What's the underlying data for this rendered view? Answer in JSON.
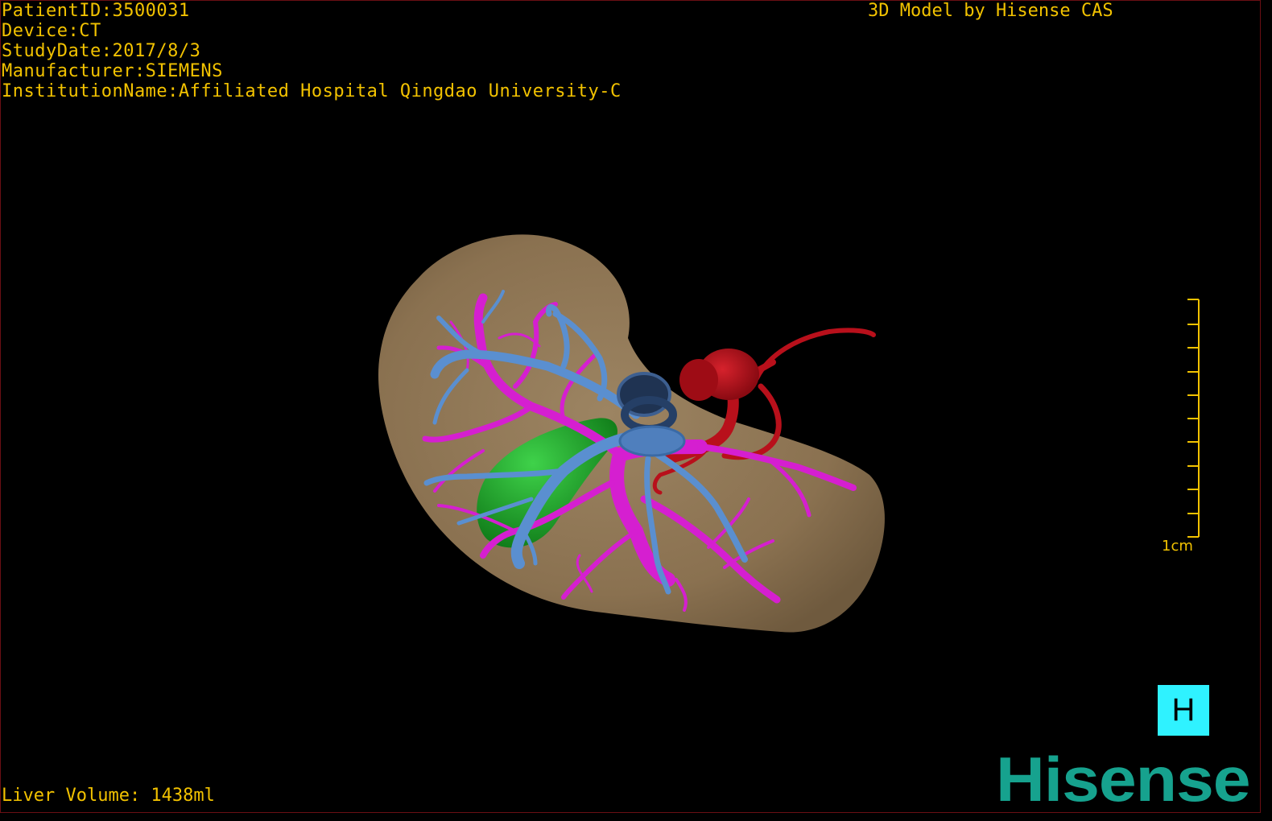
{
  "study_info": {
    "patient_id": "PatientID:3500031",
    "device": "Device:CT",
    "study_date": "StudyDate:2017/8/3",
    "manufacturer": "Manufacturer:SIEMENS",
    "institution": "InstitutionName:Affiliated Hospital Qingdao University-C"
  },
  "credit": "3D Model by Hisense CAS",
  "liver_volume": "Liver Volume: 1438ml",
  "scale_bar": {
    "label": "1cm"
  },
  "view_button": {
    "label": "H"
  },
  "logo_text": "Hisense",
  "colors": {
    "text": "#f2c200",
    "liver": "#8c7452",
    "portal_vein": "#d51fd0",
    "hepatic_vein": "#5a8fd0",
    "artery": "#b8101b",
    "gallbladder": "#1fa82a",
    "view_button_bg": "#2ff2ff",
    "logo": "#16a28e"
  }
}
